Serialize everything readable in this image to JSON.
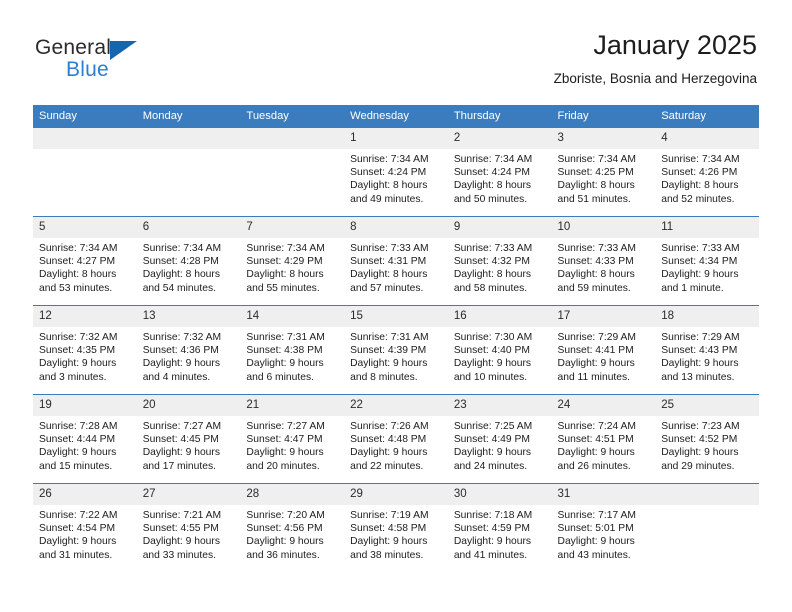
{
  "brand": {
    "word1": "General",
    "word2": "Blue",
    "logo_color": "#1565b0",
    "blue_text_color": "#2a7fd4"
  },
  "header": {
    "title": "January 2025",
    "subtitle": "Zboriste, Bosnia and Herzegovina"
  },
  "theme": {
    "header_blue": "#3a7cbe",
    "daynum_band": "#efefef",
    "text": "#1d1d1d"
  },
  "weekdays": [
    "Sunday",
    "Monday",
    "Tuesday",
    "Wednesday",
    "Thursday",
    "Friday",
    "Saturday"
  ],
  "weeks": [
    [
      {
        "day": "",
        "empty": true
      },
      {
        "day": "",
        "empty": true
      },
      {
        "day": "",
        "empty": true
      },
      {
        "day": "1",
        "sunrise": "Sunrise: 7:34 AM",
        "sunset": "Sunset: 4:24 PM",
        "daylight1": "Daylight: 8 hours",
        "daylight2": "and 49 minutes."
      },
      {
        "day": "2",
        "sunrise": "Sunrise: 7:34 AM",
        "sunset": "Sunset: 4:24 PM",
        "daylight1": "Daylight: 8 hours",
        "daylight2": "and 50 minutes."
      },
      {
        "day": "3",
        "sunrise": "Sunrise: 7:34 AM",
        "sunset": "Sunset: 4:25 PM",
        "daylight1": "Daylight: 8 hours",
        "daylight2": "and 51 minutes."
      },
      {
        "day": "4",
        "sunrise": "Sunrise: 7:34 AM",
        "sunset": "Sunset: 4:26 PM",
        "daylight1": "Daylight: 8 hours",
        "daylight2": "and 52 minutes."
      }
    ],
    [
      {
        "day": "5",
        "sunrise": "Sunrise: 7:34 AM",
        "sunset": "Sunset: 4:27 PM",
        "daylight1": "Daylight: 8 hours",
        "daylight2": "and 53 minutes."
      },
      {
        "day": "6",
        "sunrise": "Sunrise: 7:34 AM",
        "sunset": "Sunset: 4:28 PM",
        "daylight1": "Daylight: 8 hours",
        "daylight2": "and 54 minutes."
      },
      {
        "day": "7",
        "sunrise": "Sunrise: 7:34 AM",
        "sunset": "Sunset: 4:29 PM",
        "daylight1": "Daylight: 8 hours",
        "daylight2": "and 55 minutes."
      },
      {
        "day": "8",
        "sunrise": "Sunrise: 7:33 AM",
        "sunset": "Sunset: 4:31 PM",
        "daylight1": "Daylight: 8 hours",
        "daylight2": "and 57 minutes."
      },
      {
        "day": "9",
        "sunrise": "Sunrise: 7:33 AM",
        "sunset": "Sunset: 4:32 PM",
        "daylight1": "Daylight: 8 hours",
        "daylight2": "and 58 minutes."
      },
      {
        "day": "10",
        "sunrise": "Sunrise: 7:33 AM",
        "sunset": "Sunset: 4:33 PM",
        "daylight1": "Daylight: 8 hours",
        "daylight2": "and 59 minutes."
      },
      {
        "day": "11",
        "sunrise": "Sunrise: 7:33 AM",
        "sunset": "Sunset: 4:34 PM",
        "daylight1": "Daylight: 9 hours",
        "daylight2": "and 1 minute."
      }
    ],
    [
      {
        "day": "12",
        "sunrise": "Sunrise: 7:32 AM",
        "sunset": "Sunset: 4:35 PM",
        "daylight1": "Daylight: 9 hours",
        "daylight2": "and 3 minutes."
      },
      {
        "day": "13",
        "sunrise": "Sunrise: 7:32 AM",
        "sunset": "Sunset: 4:36 PM",
        "daylight1": "Daylight: 9 hours",
        "daylight2": "and 4 minutes."
      },
      {
        "day": "14",
        "sunrise": "Sunrise: 7:31 AM",
        "sunset": "Sunset: 4:38 PM",
        "daylight1": "Daylight: 9 hours",
        "daylight2": "and 6 minutes."
      },
      {
        "day": "15",
        "sunrise": "Sunrise: 7:31 AM",
        "sunset": "Sunset: 4:39 PM",
        "daylight1": "Daylight: 9 hours",
        "daylight2": "and 8 minutes."
      },
      {
        "day": "16",
        "sunrise": "Sunrise: 7:30 AM",
        "sunset": "Sunset: 4:40 PM",
        "daylight1": "Daylight: 9 hours",
        "daylight2": "and 10 minutes."
      },
      {
        "day": "17",
        "sunrise": "Sunrise: 7:29 AM",
        "sunset": "Sunset: 4:41 PM",
        "daylight1": "Daylight: 9 hours",
        "daylight2": "and 11 minutes."
      },
      {
        "day": "18",
        "sunrise": "Sunrise: 7:29 AM",
        "sunset": "Sunset: 4:43 PM",
        "daylight1": "Daylight: 9 hours",
        "daylight2": "and 13 minutes."
      }
    ],
    [
      {
        "day": "19",
        "sunrise": "Sunrise: 7:28 AM",
        "sunset": "Sunset: 4:44 PM",
        "daylight1": "Daylight: 9 hours",
        "daylight2": "and 15 minutes."
      },
      {
        "day": "20",
        "sunrise": "Sunrise: 7:27 AM",
        "sunset": "Sunset: 4:45 PM",
        "daylight1": "Daylight: 9 hours",
        "daylight2": "and 17 minutes."
      },
      {
        "day": "21",
        "sunrise": "Sunrise: 7:27 AM",
        "sunset": "Sunset: 4:47 PM",
        "daylight1": "Daylight: 9 hours",
        "daylight2": "and 20 minutes."
      },
      {
        "day": "22",
        "sunrise": "Sunrise: 7:26 AM",
        "sunset": "Sunset: 4:48 PM",
        "daylight1": "Daylight: 9 hours",
        "daylight2": "and 22 minutes."
      },
      {
        "day": "23",
        "sunrise": "Sunrise: 7:25 AM",
        "sunset": "Sunset: 4:49 PM",
        "daylight1": "Daylight: 9 hours",
        "daylight2": "and 24 minutes."
      },
      {
        "day": "24",
        "sunrise": "Sunrise: 7:24 AM",
        "sunset": "Sunset: 4:51 PM",
        "daylight1": "Daylight: 9 hours",
        "daylight2": "and 26 minutes."
      },
      {
        "day": "25",
        "sunrise": "Sunrise: 7:23 AM",
        "sunset": "Sunset: 4:52 PM",
        "daylight1": "Daylight: 9 hours",
        "daylight2": "and 29 minutes."
      }
    ],
    [
      {
        "day": "26",
        "sunrise": "Sunrise: 7:22 AM",
        "sunset": "Sunset: 4:54 PM",
        "daylight1": "Daylight: 9 hours",
        "daylight2": "and 31 minutes."
      },
      {
        "day": "27",
        "sunrise": "Sunrise: 7:21 AM",
        "sunset": "Sunset: 4:55 PM",
        "daylight1": "Daylight: 9 hours",
        "daylight2": "and 33 minutes."
      },
      {
        "day": "28",
        "sunrise": "Sunrise: 7:20 AM",
        "sunset": "Sunset: 4:56 PM",
        "daylight1": "Daylight: 9 hours",
        "daylight2": "and 36 minutes."
      },
      {
        "day": "29",
        "sunrise": "Sunrise: 7:19 AM",
        "sunset": "Sunset: 4:58 PM",
        "daylight1": "Daylight: 9 hours",
        "daylight2": "and 38 minutes."
      },
      {
        "day": "30",
        "sunrise": "Sunrise: 7:18 AM",
        "sunset": "Sunset: 4:59 PM",
        "daylight1": "Daylight: 9 hours",
        "daylight2": "and 41 minutes."
      },
      {
        "day": "31",
        "sunrise": "Sunrise: 7:17 AM",
        "sunset": "Sunset: 5:01 PM",
        "daylight1": "Daylight: 9 hours",
        "daylight2": "and 43 minutes."
      },
      {
        "day": "",
        "empty": true
      }
    ]
  ]
}
